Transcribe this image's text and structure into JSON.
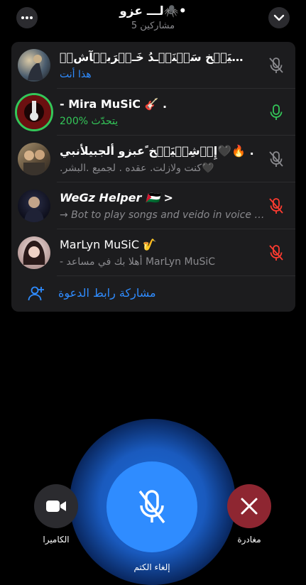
{
  "header": {
    "title": "لـــ عزو🕷️•",
    "participants": "5 مشاركين"
  },
  "colors": {
    "accent": "#2f8cff",
    "speaking": "#34c759",
    "muted_red": "#ff3b30",
    "muted_gray": "#8a8a8e",
    "panel": "#1c1c1e",
    "leave": "#8e2631"
  },
  "participants": [
    {
      "name": "إِۛۙشِۛۙيَۛۙخ سَۛۙنَۛۙـدُ خَـۛۙرَبۛۙآشۛۙ 💋",
      "status": "هذا أنت",
      "status_color": "#2f8cff",
      "mic": "muted-gray"
    },
    {
      "name": "- Mira MuSiC 🎸 .",
      "status": "200% يتحدّث",
      "status_color": "#34c759",
      "mic": "speaking"
    },
    {
      "name": "إِۛۙشِۛۙيَۛۙخ ًعبزو ألجبيلأنبي🖤🔥 .",
      "status": ".كنت ولازلت. عقده . لجميع .البشر🖤",
      "status_color": "#8a8a8e",
      "mic": "muted-gray"
    },
    {
      "name": "WeGz Helper 🇵🇸 >",
      "status": "→ Bot to play songs and veido in voice chat",
      "status_color": "#8a8a8e",
      "mic": "muted-red"
    },
    {
      "name": "MarLyn MuSiC 🎷",
      "status": "- أهلا بك في مساعد MarLyn MuSiC",
      "status_color": "#8a8a8e",
      "mic": "muted-red"
    }
  ],
  "invite": {
    "label": "مشاركة رابط الدعوة"
  },
  "controls": {
    "camera_label": "الكاميرا",
    "leave_label": "مغادرة",
    "mic_label": "إلغاء الكتم"
  }
}
